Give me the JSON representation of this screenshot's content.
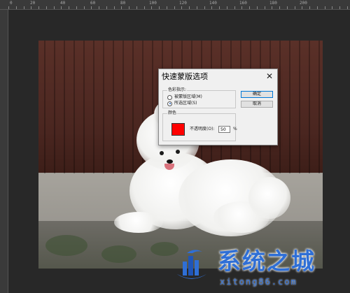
{
  "ruler": {
    "labels": [
      "0",
      "20",
      "40",
      "60",
      "80",
      "100",
      "120",
      "140",
      "160",
      "180",
      "200"
    ]
  },
  "dialog": {
    "title": "快速蒙版选项",
    "close_icon": "close-icon",
    "color_indicates": {
      "label": "色彩指示:",
      "options": [
        {
          "label": "被蒙版区域(M)",
          "checked": false
        },
        {
          "label": "所选区域(S)",
          "checked": true
        }
      ]
    },
    "color_group": {
      "label": "颜色",
      "swatch_color": "#ff0000",
      "opacity_label": "不透明度(O):",
      "opacity_value": "50",
      "opacity_unit": "%"
    },
    "buttons": {
      "ok": "确定",
      "cancel": "取消"
    }
  },
  "watermark": {
    "text": "系统之城",
    "url": "xitong86.com",
    "color": "#2f6fd6"
  }
}
